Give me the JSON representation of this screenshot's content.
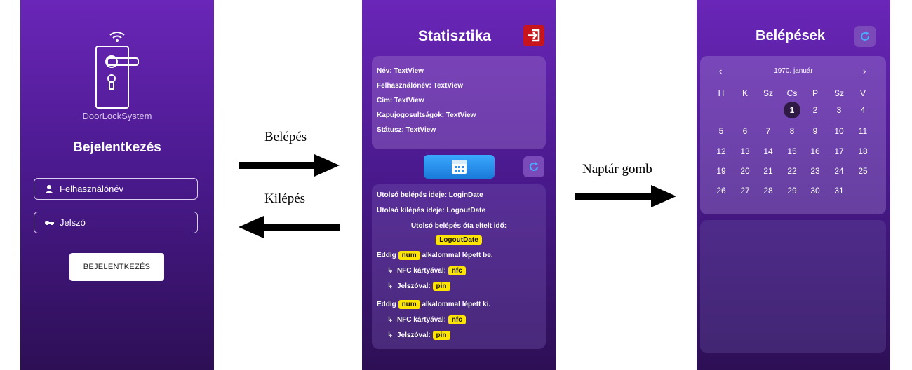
{
  "login": {
    "app_name": "DoorLockSystem",
    "title": "Bejelentkezés",
    "username_placeholder": "Felhasználónév",
    "password_placeholder": "Jelszó",
    "button": "BEJELENTKEZÉS"
  },
  "flow": {
    "login_label": "Belépés",
    "logout_label": "Kilépés",
    "calendar_label": "Naptár gomb"
  },
  "stats": {
    "title": "Statisztika",
    "info": [
      "Név: TextView",
      "Felhasználónév: TextView",
      "Cím: TextView",
      "Kapujogosultságok: TextView",
      "Státusz: TextView"
    ],
    "last_login": "Utolsó belépés ideje: LoginDate",
    "last_logout": "Utolsó kilépés ideje: LogoutDate",
    "elapsed_label": "Utolsó belépés óta eltelt idő:",
    "elapsed_value": "LogoutDate",
    "in_prefix": "Eddig",
    "in_badge": "num",
    "in_suffix": "alkalommal lépett be.",
    "out_prefix": "Eddig",
    "out_badge": "num",
    "out_suffix": "alkalommal lépett ki.",
    "arrow_glyph": "↳",
    "nfc_label": "NFC kártyával:",
    "nfc_badge": "nfc",
    "pin_label": "Jelszóval:",
    "pin_badge": "pin"
  },
  "entries": {
    "title": "Belépések",
    "month": "1970. január",
    "prev": "‹",
    "next": "›",
    "weekdays": [
      "H",
      "K",
      "Sz",
      "Cs",
      "P",
      "Sz",
      "V"
    ],
    "selected_day": "1",
    "days": [
      "1",
      "2",
      "3",
      "4",
      "5",
      "6",
      "7",
      "8",
      "9",
      "10",
      "11",
      "12",
      "13",
      "14",
      "15",
      "16",
      "17",
      "18",
      "19",
      "20",
      "21",
      "22",
      "23",
      "24",
      "25",
      "26",
      "27",
      "28",
      "29",
      "30",
      "31"
    ]
  },
  "colors": {
    "exit_button": "#c8141c",
    "badge": "#ffe400",
    "calendar_button": "#2a90ee"
  }
}
